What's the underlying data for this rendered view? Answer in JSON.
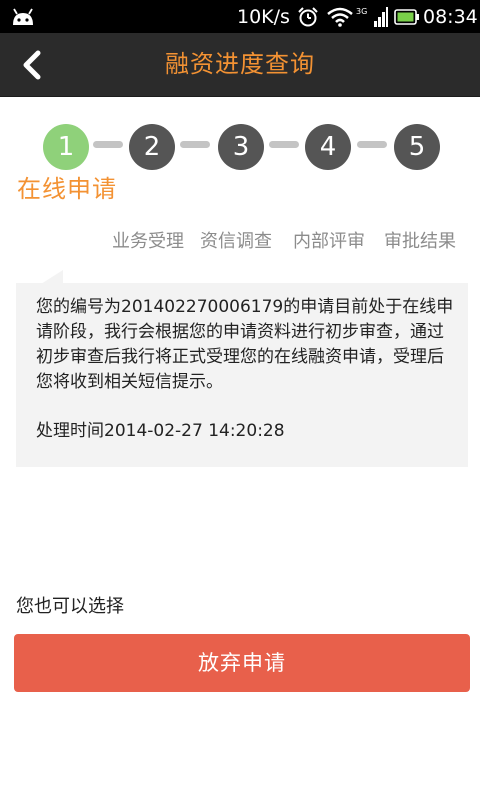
{
  "status_bar": {
    "network_speed": "10K/s",
    "signal_label": "3G",
    "time": "08:34",
    "icons": [
      "android-icon",
      "alarm-icon",
      "wifi-icon",
      "signal-icon",
      "battery-icon"
    ]
  },
  "header": {
    "title": "融资进度查询",
    "back_icon": "back-arrow-icon"
  },
  "progress": {
    "current_step": 1,
    "steps": [
      "1",
      "2",
      "3",
      "4",
      "5"
    ],
    "current_stage": "在线申请",
    "stage_labels": [
      "业务受理",
      "资信调查",
      "内部评审",
      "审批结果"
    ]
  },
  "message": {
    "body": "您的编号为20140227000617​9的申请目前处于在线申请阶段，我行会根据您的申请资料进行初步审查，通过初步审查后我行将正式受理您的在线融资申请，受理后您将收到相关短信提示。",
    "process_time": "处理时间2014-02-27 14:20:28"
  },
  "actions": {
    "choose_label": "您也可以选择",
    "abandon_button": "放弃申请"
  },
  "colors": {
    "accent": "#f39233",
    "active_step": "#8fd17a",
    "inactive_step": "#555555",
    "button": "#e8604b",
    "header_bg": "#2b2b2b"
  }
}
